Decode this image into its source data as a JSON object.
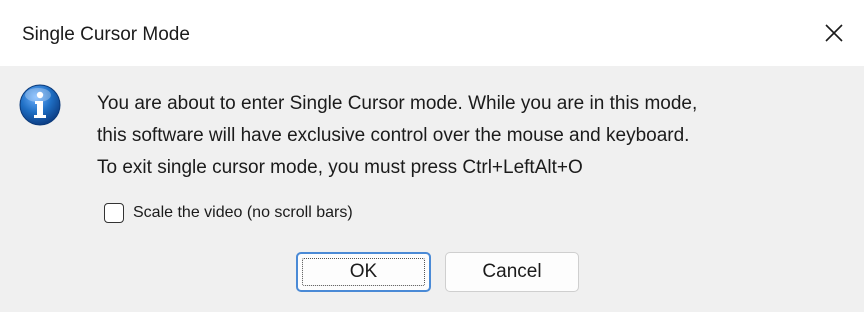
{
  "window": {
    "title": "Single Cursor Mode",
    "close_icon": "close-icon"
  },
  "message": {
    "icon": "info-icon",
    "lines": [
      "You are about to enter Single Cursor mode.  While you are in this mode,",
      "this software will have exclusive control over the mouse and keyboard.",
      "To exit single cursor mode, you must press Ctrl+LeftAlt+O"
    ]
  },
  "options": {
    "scale_video": {
      "label": "Scale the video (no scroll bars)",
      "checked": false
    }
  },
  "buttons": {
    "ok": "OK",
    "cancel": "Cancel"
  },
  "colors": {
    "background": "#f0f0f0",
    "titlebar": "#ffffff",
    "ok_border": "#4a8ad6",
    "icon_blue": "#1f6fc4"
  }
}
